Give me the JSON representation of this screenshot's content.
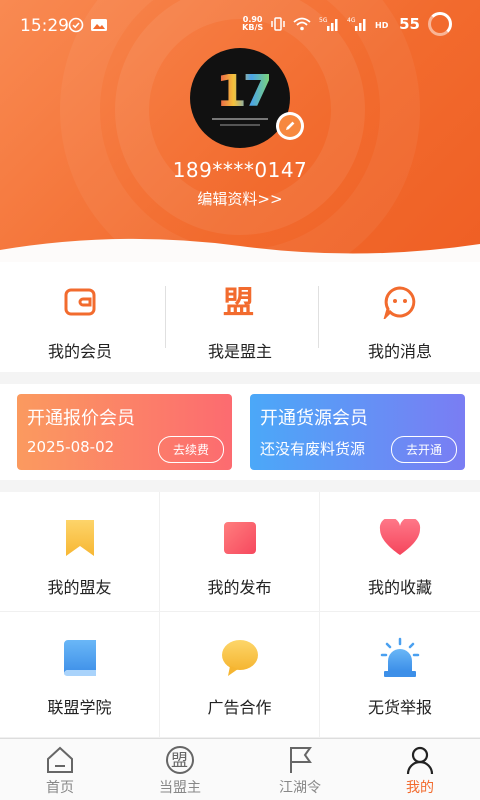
{
  "status_bar": {
    "time": "15:29",
    "network_speed": "0.90",
    "network_unit": "KB/S",
    "battery": "55"
  },
  "profile": {
    "phone": "189****0147",
    "edit_link": "编辑资料>>"
  },
  "quick_menu": [
    {
      "label": "我的会员",
      "icon": "wallet-icon"
    },
    {
      "label": "我是盟主",
      "icon": "alliance-icon"
    },
    {
      "label": "我的消息",
      "icon": "message-icon"
    }
  ],
  "membership_cards": [
    {
      "title": "开通报价会员",
      "subtitle": "2025-08-02",
      "button": "去续费",
      "color_from": "#fb9a5f",
      "color_to": "#fc6b70"
    },
    {
      "title": "开通货源会员",
      "subtitle": "还没有废料货源",
      "button": "去开通",
      "color_from": "#4ba8f8",
      "color_to": "#7a7df3"
    }
  ],
  "grid": [
    {
      "label": "我的盟友",
      "icon": "bookmark-icon"
    },
    {
      "label": "我的发布",
      "icon": "square-icon"
    },
    {
      "label": "我的收藏",
      "icon": "heart-icon"
    },
    {
      "label": "联盟学院",
      "icon": "book-icon"
    },
    {
      "label": "广告合作",
      "icon": "chat-bubble-icon"
    },
    {
      "label": "无货举报",
      "icon": "alarm-light-icon"
    }
  ],
  "nav": [
    {
      "label": "首页",
      "icon": "home-icon"
    },
    {
      "label": "当盟主",
      "icon": "alliance-circle-icon"
    },
    {
      "label": "江湖令",
      "icon": "flag-icon"
    },
    {
      "label": "我的",
      "icon": "person-icon",
      "active": true
    }
  ],
  "colors": {
    "accent": "#f26b2e",
    "header_gradient_start": "#f98a52"
  }
}
